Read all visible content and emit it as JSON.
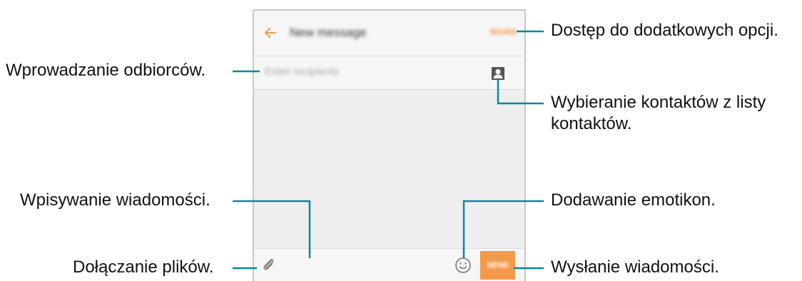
{
  "screen": {
    "appbar": {
      "title": "New message",
      "more_label": "MORE",
      "back_icon": "arrow-left-icon"
    },
    "recipients": {
      "placeholder": "Enter recipients",
      "contact_icon": "contact-icon"
    },
    "compose": {
      "attach_icon": "paperclip-icon",
      "emoji_icon": "smiley-icon",
      "send_label": "SEND"
    },
    "accent_color": "#f2994a"
  },
  "callouts": {
    "more_options": "Dostęp do dodatkowych opcji.",
    "enter_recipients": "Wprowadzanie odbiorców.",
    "select_contacts_line1": "Wybieranie kontaktów z listy",
    "select_contacts_line2": "kontaktów.",
    "type_message": "Wpisywanie wiadomości.",
    "add_emoticons": "Dodawanie emotikon.",
    "attach_files": "Dołączanie plików.",
    "send_message": "Wysłanie wiadomości."
  }
}
